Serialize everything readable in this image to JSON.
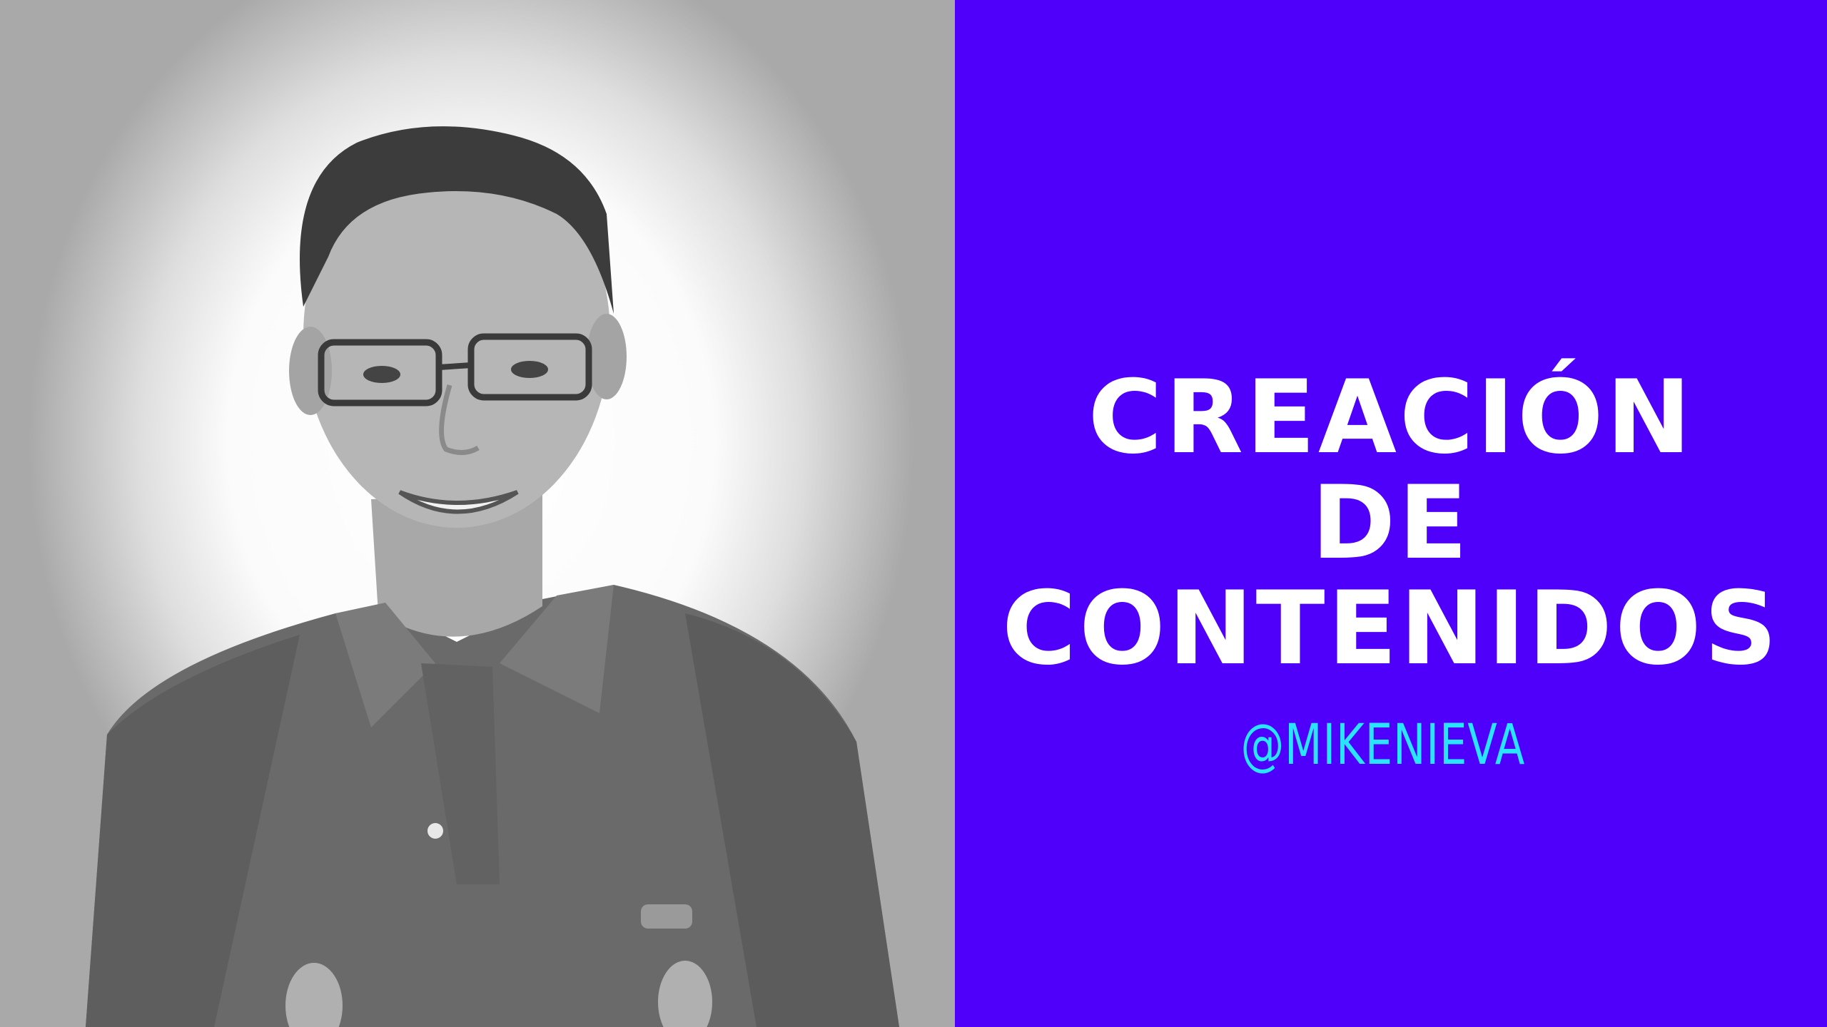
{
  "title": {
    "lines": [
      "CREACIÓN",
      "DE",
      "CONTENIDOS"
    ]
  },
  "handle": "@MIKENIEVA",
  "colors": {
    "panel_background": "#4f00fa",
    "title_text": "#ffffff",
    "handle_text": "#29e3ff"
  },
  "photo": {
    "description_icon": "person-photo",
    "style": "black-and-white"
  }
}
